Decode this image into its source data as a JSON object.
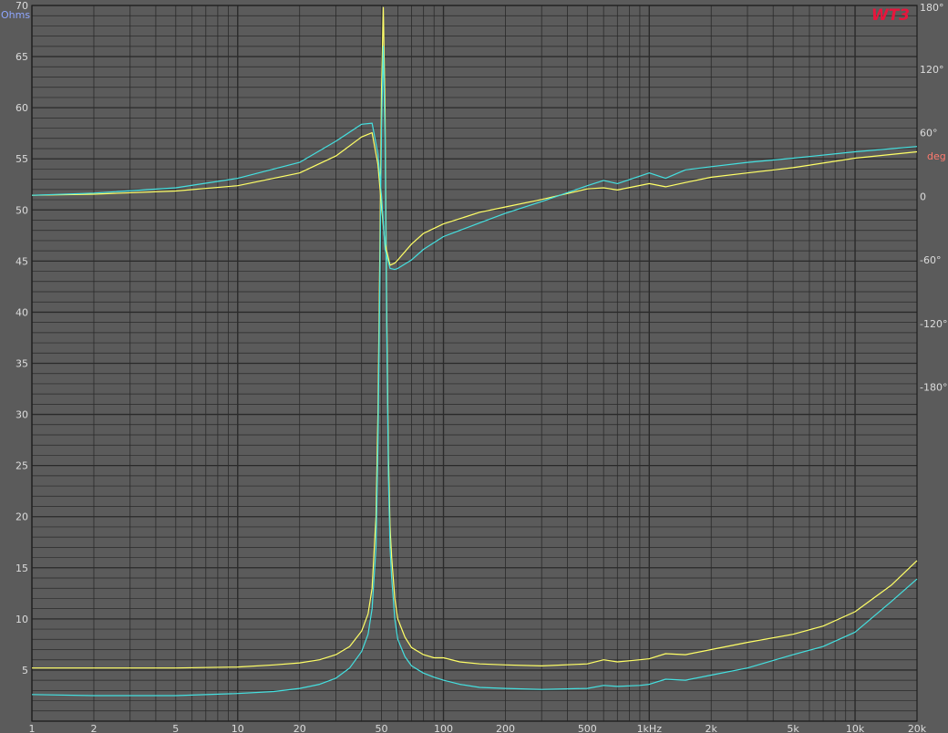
{
  "chart_data": {
    "type": "line",
    "logo": "WT3",
    "x_scale": "log",
    "xlim": [
      1,
      20000
    ],
    "x_ticks": [
      {
        "value": 1,
        "label": "1"
      },
      {
        "value": 2,
        "label": "2"
      },
      {
        "value": 5,
        "label": "5"
      },
      {
        "value": 10,
        "label": "10"
      },
      {
        "value": 20,
        "label": "20"
      },
      {
        "value": 50,
        "label": "50"
      },
      {
        "value": 100,
        "label": "100"
      },
      {
        "value": 200,
        "label": "200"
      },
      {
        "value": 500,
        "label": "500"
      },
      {
        "value": 1000,
        "label": "1kHz"
      },
      {
        "value": 2000,
        "label": "2k"
      },
      {
        "value": 5000,
        "label": "5k"
      },
      {
        "value": 10000,
        "label": "10k"
      },
      {
        "value": 20000,
        "label": "20k"
      }
    ],
    "y_left": {
      "unit": "Ohms",
      "ylim": [
        0,
        70
      ],
      "ticks": [
        "5",
        "10",
        "15",
        "20",
        "25",
        "30",
        "35",
        "40",
        "45",
        "50",
        "55",
        "60",
        "65",
        "70"
      ],
      "tick_values": [
        5,
        10,
        15,
        20,
        25,
        30,
        35,
        40,
        45,
        50,
        55,
        60,
        65,
        70
      ]
    },
    "y_right": {
      "unit": "deg",
      "ylim": [
        -495,
        180
      ],
      "ticks": [
        "180°",
        "120°",
        "60°",
        "0",
        "-60°",
        "-120°",
        "-180°"
      ],
      "tick_values": [
        180,
        120,
        60,
        0,
        -60,
        -120,
        -180
      ]
    },
    "grid": true,
    "colors": {
      "yellow": "#ffff66",
      "cyan": "#44e0e0",
      "background": "#5b5b5b",
      "grid": "#2a2a2a"
    },
    "series": [
      {
        "color": "yellow",
        "axis": "left",
        "quantity": "impedance",
        "x": [
          1,
          2,
          5,
          10,
          15,
          20,
          25,
          30,
          35,
          40,
          43,
          45,
          47,
          48,
          49,
          50,
          51,
          52,
          53,
          54,
          55,
          56,
          58,
          60,
          65,
          70,
          80,
          90,
          100,
          120,
          150,
          200,
          300,
          500,
          600,
          700,
          900,
          1000,
          1200,
          1500,
          2000,
          3000,
          5000,
          7000,
          10000,
          15000,
          20000
        ],
        "y": [
          5.2,
          5.2,
          5.2,
          5.3,
          5.5,
          5.7,
          6.0,
          6.5,
          7.3,
          8.8,
          10.5,
          13,
          20,
          30,
          45,
          62,
          69.8,
          60,
          40,
          26,
          19,
          16,
          12,
          10,
          8.2,
          7.2,
          6.5,
          6.2,
          6.2,
          5.8,
          5.6,
          5.5,
          5.4,
          5.6,
          6.0,
          5.8,
          6.0,
          6.1,
          6.6,
          6.5,
          7.0,
          7.7,
          8.5,
          9.3,
          10.7,
          13.3,
          15.7
        ]
      },
      {
        "color": "cyan",
        "axis": "left",
        "quantity": "impedance",
        "x": [
          1,
          2,
          5,
          10,
          15,
          20,
          25,
          30,
          35,
          40,
          43,
          45,
          47,
          48,
          49,
          50,
          51,
          52,
          53,
          54,
          55,
          56,
          58,
          60,
          65,
          70,
          80,
          90,
          100,
          120,
          150,
          200,
          300,
          500,
          600,
          700,
          900,
          1000,
          1200,
          1500,
          2000,
          3000,
          5000,
          7000,
          10000,
          15000,
          20000
        ],
        "y": [
          2.6,
          2.5,
          2.5,
          2.7,
          2.9,
          3.2,
          3.6,
          4.2,
          5.2,
          6.8,
          8.5,
          11,
          17,
          27,
          42,
          58,
          66,
          57,
          38,
          24,
          17,
          14,
          10,
          8,
          6.3,
          5.4,
          4.7,
          4.3,
          4.0,
          3.6,
          3.3,
          3.2,
          3.1,
          3.2,
          3.5,
          3.4,
          3.5,
          3.6,
          4.1,
          4.0,
          4.5,
          5.2,
          6.5,
          7.3,
          8.7,
          11.7,
          13.9
        ]
      },
      {
        "color": "yellow",
        "axis": "right",
        "quantity": "phase",
        "x": [
          1,
          2,
          5,
          10,
          20,
          30,
          40,
          45,
          48,
          50,
          52,
          55,
          58,
          60,
          70,
          80,
          100,
          150,
          200,
          300,
          500,
          600,
          700,
          1000,
          1200,
          1500,
          2000,
          3000,
          5000,
          10000,
          20000
        ],
        "y": [
          1,
          2,
          5,
          10,
          22,
          38,
          56,
          60,
          30,
          -10,
          -45,
          -65,
          -63,
          -60,
          -45,
          -35,
          -26,
          -15,
          -10,
          -3,
          7,
          8,
          6,
          12,
          9,
          13,
          18,
          22,
          27,
          36,
          42
        ]
      },
      {
        "color": "cyan",
        "axis": "right",
        "quantity": "phase",
        "x": [
          1,
          2,
          5,
          10,
          20,
          30,
          40,
          45,
          48,
          50,
          52,
          55,
          58,
          60,
          70,
          80,
          100,
          150,
          200,
          300,
          500,
          600,
          700,
          1000,
          1200,
          1500,
          2000,
          3000,
          5000,
          10000,
          20000
        ],
        "y": [
          1,
          3,
          8,
          17,
          32,
          52,
          68,
          69,
          40,
          0,
          -50,
          -68,
          -69,
          -68,
          -60,
          -50,
          -38,
          -25,
          -16,
          -5,
          10,
          15,
          12,
          22,
          17,
          25,
          28,
          32,
          36,
          42,
          47
        ]
      }
    ]
  }
}
